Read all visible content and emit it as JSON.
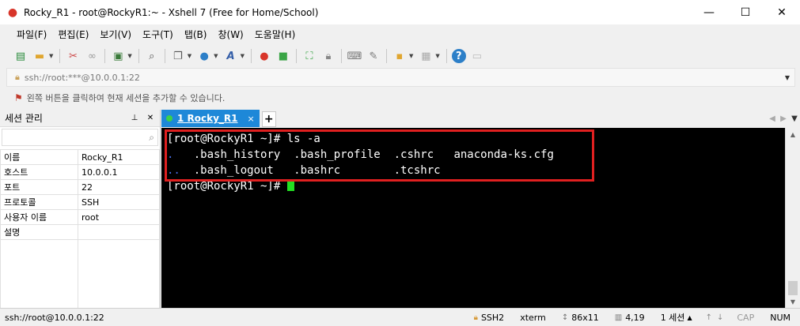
{
  "window": {
    "title": "Rocky_R1 - root@RockyR1:~ - Xshell 7 (Free for Home/School)",
    "controls": {
      "minimize": "—",
      "maximize": "☐",
      "close": "✕"
    }
  },
  "menu": [
    "파일(F)",
    "편집(E)",
    "보기(V)",
    "도구(T)",
    "탭(B)",
    "창(W)",
    "도움말(H)"
  ],
  "toolbar": {
    "icons": [
      "new-session-icon",
      "open-folder-icon",
      "disconnect-icon",
      "reconnect-icon",
      "properties-icon",
      "find-icon",
      "copy-icon",
      "globe-icon",
      "font-icon",
      "xshell-logo-icon",
      "xftp-icon",
      "fullscreen-icon",
      "lock-icon",
      "keyboard-icon",
      "compose-icon",
      "layout-icon",
      "help-icon",
      "chat-icon"
    ]
  },
  "address": {
    "value": "ssh://root:***@10.0.0.1:22"
  },
  "hint": {
    "text": "왼쪽 버튼을 클릭하여 현재 세션을 추가할 수 있습니다."
  },
  "session_panel": {
    "title": "세션 관리",
    "pin": "ᵖ",
    "close": "✕",
    "search_placeholder": "",
    "properties": [
      {
        "key": "이름",
        "value": "Rocky_R1"
      },
      {
        "key": "호스트",
        "value": "10.0.0.1"
      },
      {
        "key": "포트",
        "value": "22"
      },
      {
        "key": "프로토콜",
        "value": "SSH"
      },
      {
        "key": "사용자 이름",
        "value": "root"
      },
      {
        "key": "설명",
        "value": ""
      }
    ]
  },
  "tabs": [
    {
      "label": "1 Rocky_R1",
      "close": "×",
      "active": true
    }
  ],
  "tab_add": "+",
  "terminal": {
    "prompt1": "[root@RockyR1 ~]# ",
    "command": "ls -a",
    "row1_dot": ".",
    "row1_rest": "   .bash_history  .bash_profile  .cshrc   anaconda-ks.cfg",
    "row2_dot": "..",
    "row2_rest": "  .bash_logout   .bashrc        .tcshrc",
    "prompt2": "[root@RockyR1 ~]# "
  },
  "status": {
    "address": "ssh://root@10.0.0.1:22",
    "protocol": "SSH2",
    "term": "xterm",
    "size": "86x11",
    "cursor": "4,19",
    "sessions": "1 세션",
    "caps": "CAP",
    "num": "NUM"
  },
  "colors": {
    "tab_active": "#1e88d8",
    "terminal_bg": "#000000",
    "highlight": "#e02020",
    "cursor": "#22dd22",
    "dir_blue": "#4a6ee6"
  }
}
